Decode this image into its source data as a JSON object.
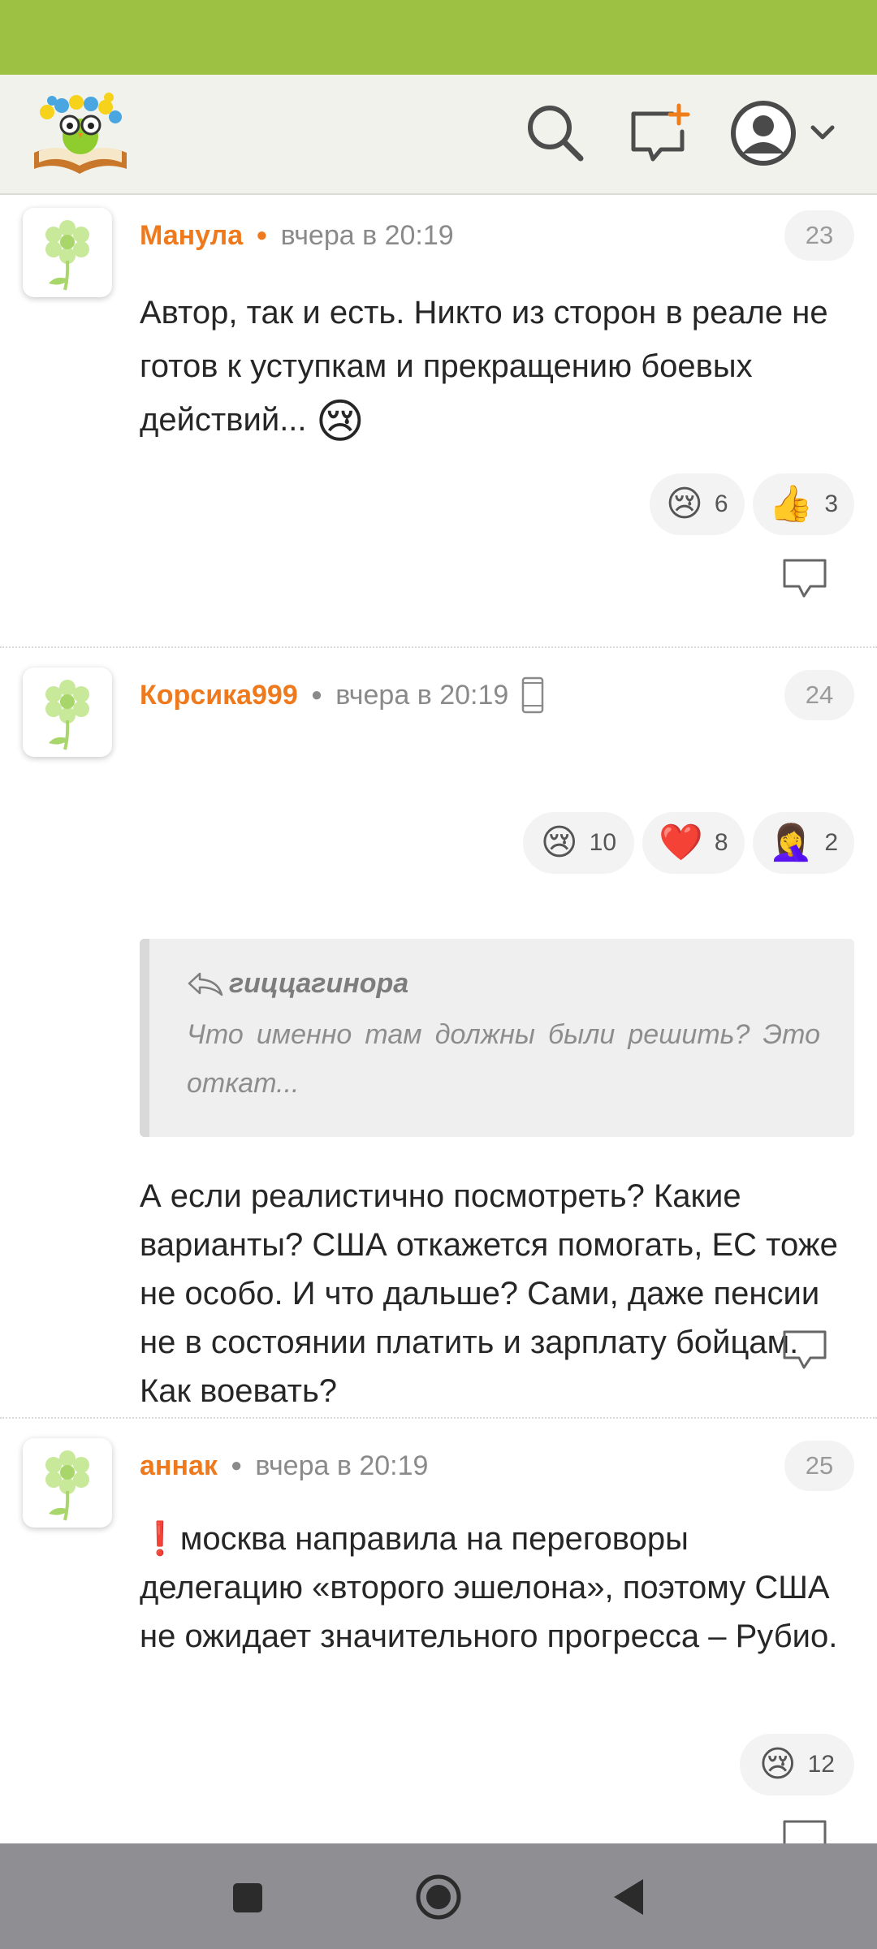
{
  "header": {
    "logo_name": "owl-book-logo",
    "icons": [
      "search-icon",
      "new-post-icon",
      "profile-avatar-icon",
      "chevron-down-icon"
    ]
  },
  "comments": [
    {
      "author": "Манула",
      "time": "вчера в 20:19",
      "number": "23",
      "text": "Автор, так и есть. Никто из сторон в реале не готов к уступкам и прекращению боевых действий...",
      "inline_emoji": "😢",
      "reactions": [
        {
          "emoji": "😢",
          "count": "6"
        },
        {
          "emoji": "👍",
          "count": "3"
        }
      ]
    },
    {
      "author": "Корсика999",
      "time": "вчера в 20:19",
      "number": "24",
      "device_icon": "mobile-phone-icon",
      "quote": {
        "author": "гиццагинора",
        "text": "Что именно там должны были решить? Это откат..."
      },
      "text": "А если реалистично посмотреть? Какие варианты? США откажется помогать, ЕС тоже не особо. И что дальше? Сами, даже пенсии не в состоянии платить и зарплату бойцам. Как воевать?",
      "reactions": [
        {
          "emoji": "😢",
          "count": "10"
        },
        {
          "emoji": "❤️",
          "count": "8"
        },
        {
          "emoji": "🤦‍♀️",
          "count": "2"
        }
      ]
    },
    {
      "author": "аннак",
      "time": "вчера в 20:19",
      "number": "25",
      "text_prefix_emoji": "❗",
      "text": "москва направила на переговоры делегацию «второго эшелона», поэтому США не ожидает значительного прогресса – Рубио.",
      "reactions": [
        {
          "emoji": "😢",
          "count": "12"
        }
      ]
    }
  ],
  "navbar": {
    "buttons": [
      "recent-apps-button",
      "home-button",
      "back-button"
    ]
  }
}
